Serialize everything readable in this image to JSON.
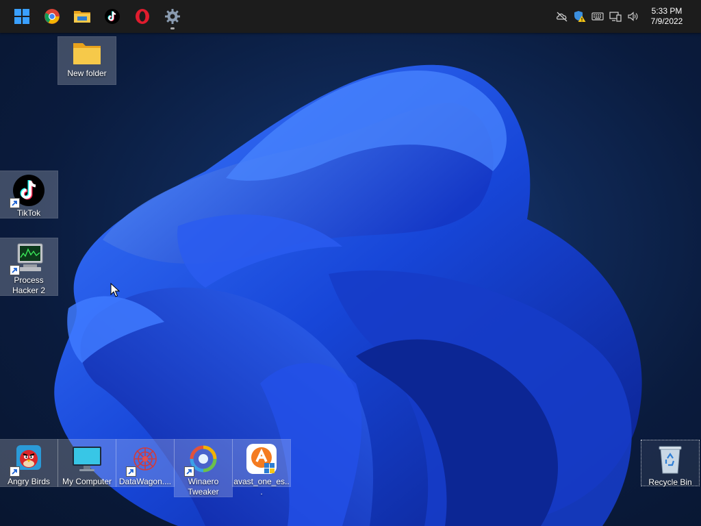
{
  "taskbar": {
    "pinned": [
      {
        "name": "start-button",
        "icon": "windows-logo-icon"
      },
      {
        "name": "chrome",
        "icon": "chrome-icon"
      },
      {
        "name": "file-explorer",
        "icon": "folder-icon"
      },
      {
        "name": "tiktok",
        "icon": "tiktok-icon"
      },
      {
        "name": "opera",
        "icon": "opera-icon"
      },
      {
        "name": "settings",
        "icon": "gear-icon"
      }
    ],
    "tray_icons": [
      "network-off-icon",
      "security-warning-icon",
      "keyboard-icon",
      "display-icon",
      "volume-icon"
    ],
    "clock": {
      "time": "5:33 PM",
      "date": "7/9/2022"
    }
  },
  "desktop_icons": {
    "new_folder": "New folder",
    "tiktok": "TikTok",
    "process_hacker": "Process Hacker 2",
    "angry_birds": "Angry Birds",
    "my_computer": "My Computer",
    "datawagon": "DataWagon....",
    "winaero": "Winaero Tweaker",
    "avast": "avast_one_es...",
    "recycle_bin": "Recycle Bin"
  },
  "colors": {
    "taskbar": "#1c1c1c",
    "wallpaper_dark": "#0a1b3d",
    "bloom_blue": "#1f4fe0",
    "folder_yellow": "#f6c94a"
  }
}
